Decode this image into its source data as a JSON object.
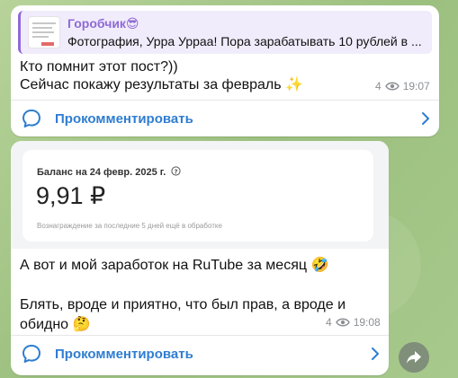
{
  "messages": [
    {
      "reply": {
        "author": "Горобчик😎",
        "text": "Фотография, Урра Урраа! Пора зарабатывать 10 рублей в ..."
      },
      "text": "Кто помнит этот пост?))\nСейчас покажу результаты за февраль ✨",
      "views": "4",
      "time": "19:07",
      "comment_label": "Прокомментировать"
    },
    {
      "card": {
        "title": "Баланс на 24 февр. 2025 г.",
        "amount": "9,91 ₽",
        "note": "Вознаграждение за последние 5 дней ещё в обработке"
      },
      "text": "А вот и мой заработок на RuTube за месяц 🤣\n\nБлять, вроде и приятно, что был прав, а вроде и обидно 🤔",
      "views": "4",
      "time": "19:08",
      "comment_label": "Прокомментировать"
    }
  ],
  "colors": {
    "accent": "#2f7dd1",
    "reply_author": "#8f6ad6",
    "meta": "#8b8f93"
  },
  "icons": [
    "eye-icon",
    "comment-icon",
    "chevron-right-icon",
    "info-icon",
    "share-icon"
  ]
}
